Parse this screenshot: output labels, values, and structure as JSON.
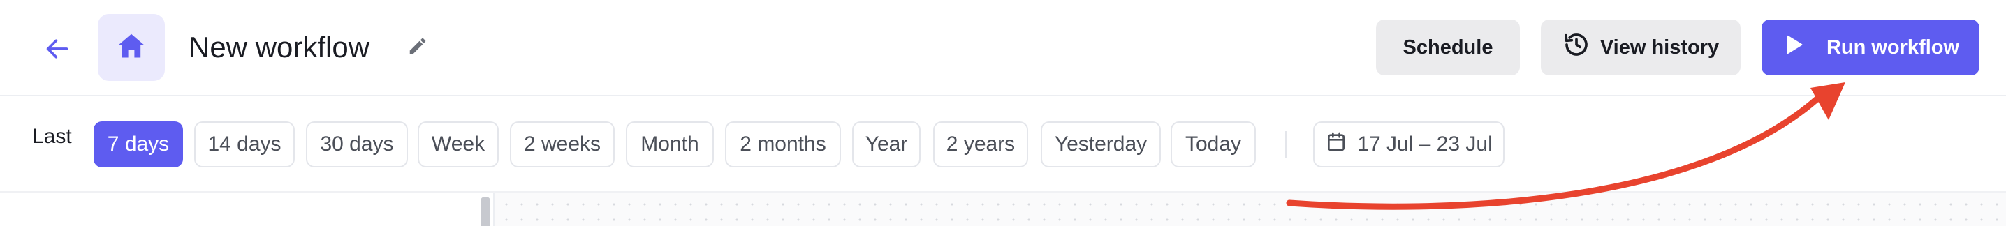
{
  "header": {
    "title": "New workflow",
    "back_icon": "arrow-left-icon",
    "home_icon": "home-icon",
    "edit_icon": "pencil-icon",
    "buttons": {
      "schedule": "Schedule",
      "view_history": "View history",
      "run_workflow": "Run workflow"
    },
    "history_icon": "history-icon",
    "run_icon": "play-icon"
  },
  "filters": {
    "label": "Last",
    "ranges": [
      "7 days",
      "14 days",
      "30 days",
      "Week",
      "2 weeks",
      "Month",
      "2 months",
      "Year",
      "2 years",
      "Yesterday",
      "Today"
    ],
    "selected": "7 days",
    "date_range": "17 Jul – 23 Jul",
    "calendar_icon": "calendar-icon"
  },
  "annotation": {
    "type": "curved-arrow",
    "target": "run-workflow-button",
    "color": "#e8432e"
  },
  "colors": {
    "accent": "#5e5cf0",
    "accent_soft": "#ebeafd",
    "button_gray": "#ebebed",
    "annotation": "#e8432e"
  }
}
